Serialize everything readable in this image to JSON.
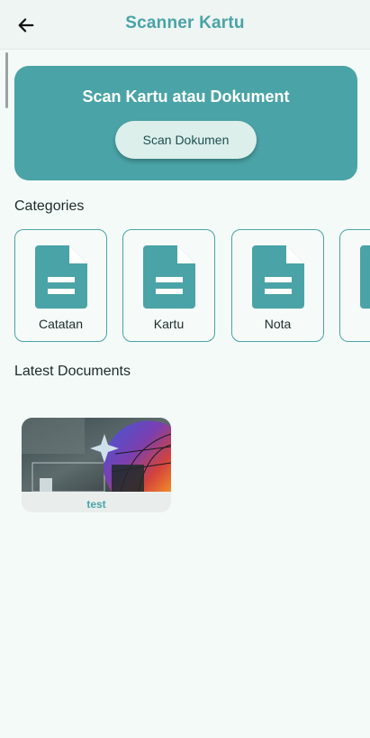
{
  "appbar": {
    "title": "Scanner Kartu",
    "back_icon": "arrow-left-icon"
  },
  "hero": {
    "title": "Scan Kartu atau Dokument",
    "button_label": "Scan Dokumen",
    "color": "#4aa3a6"
  },
  "categories": {
    "heading": "Categories",
    "items": [
      {
        "label": "Catatan",
        "icon": "document-icon"
      },
      {
        "label": "Kartu",
        "icon": "document-icon"
      },
      {
        "label": "Nota",
        "icon": "document-icon"
      },
      {
        "label": "",
        "icon": "document-icon"
      }
    ]
  },
  "documents": {
    "heading": "Latest Documents",
    "items": [
      {
        "name": "test",
        "thumbnail": "document-thumbnail-image"
      }
    ]
  },
  "colors": {
    "accent": "#4aa3a6",
    "background": "#f4faf8"
  }
}
